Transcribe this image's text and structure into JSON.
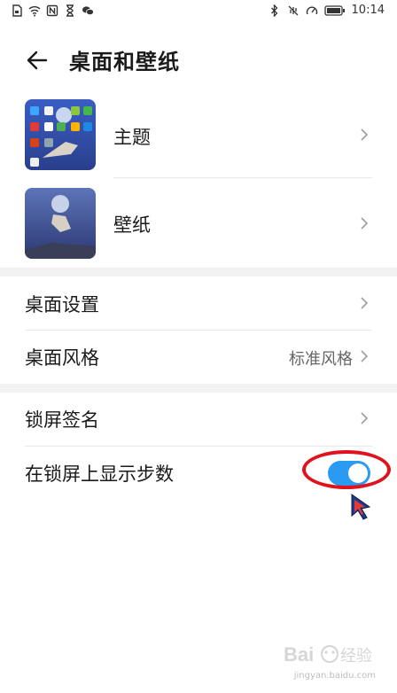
{
  "status_bar": {
    "time": "10:14",
    "icons_left": [
      "sim-icon",
      "wifi-icon",
      "nfc-icon",
      "hourglass-icon",
      "wechat-icon"
    ],
    "icons_right": [
      "bluetooth-icon",
      "vibrate-icon",
      "speed-icon",
      "battery-icon"
    ]
  },
  "header": {
    "title": "桌面和壁纸"
  },
  "media_rows": [
    {
      "label": "主题"
    },
    {
      "label": "壁纸"
    }
  ],
  "settings_rows": [
    {
      "label": "桌面设置",
      "value": ""
    },
    {
      "label": "桌面风格",
      "value": "标准风格"
    },
    {
      "label": "锁屏签名",
      "value": ""
    },
    {
      "label": "在锁屏上显示步数",
      "value": ""
    }
  ],
  "toggle_steps": {
    "on": true
  },
  "watermark": {
    "url": "jingyan.baidu.com"
  },
  "colors": {
    "accent": "#2a9af2",
    "annotation": "#e0121e"
  }
}
